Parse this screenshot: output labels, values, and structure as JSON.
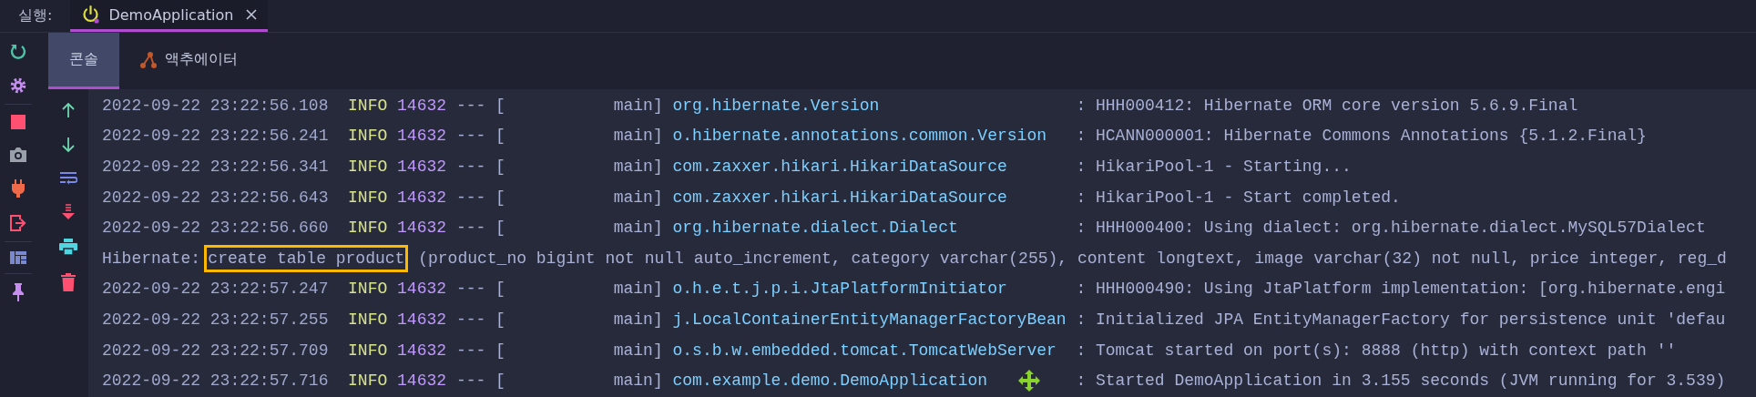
{
  "run_bar": {
    "label": "실행:",
    "tabs": [
      {
        "title": "DemoApplication",
        "selected": true
      }
    ]
  },
  "tool_tabs": [
    {
      "label": "콘솔",
      "kind": "console",
      "selected": true
    },
    {
      "label": "액추에이터",
      "kind": "actuator",
      "selected": false
    }
  ],
  "console_lines": [
    {
      "kind": "log",
      "timestamp": "2022-09-22 23:22:56.108",
      "level": "INFO",
      "pid": "14632",
      "separator": "---",
      "thread": "[           main]",
      "logger": "org.hibernate.Version",
      "message": ": HHH000412: Hibernate ORM core version 5.6.9.Final"
    },
    {
      "kind": "log",
      "timestamp": "2022-09-22 23:22:56.241",
      "level": "INFO",
      "pid": "14632",
      "separator": "---",
      "thread": "[           main]",
      "logger": "o.hibernate.annotations.common.Version",
      "message": ": HCANN000001: Hibernate Commons Annotations {5.1.2.Final}"
    },
    {
      "kind": "log",
      "timestamp": "2022-09-22 23:22:56.341",
      "level": "INFO",
      "pid": "14632",
      "separator": "---",
      "thread": "[           main]",
      "logger": "com.zaxxer.hikari.HikariDataSource",
      "message": ": HikariPool-1 - Starting..."
    },
    {
      "kind": "log",
      "timestamp": "2022-09-22 23:22:56.643",
      "level": "INFO",
      "pid": "14632",
      "separator": "---",
      "thread": "[           main]",
      "logger": "com.zaxxer.hikari.HikariDataSource",
      "message": ": HikariPool-1 - Start completed."
    },
    {
      "kind": "log",
      "timestamp": "2022-09-22 23:22:56.660",
      "level": "INFO",
      "pid": "14632",
      "separator": "---",
      "thread": "[           main]",
      "logger": "org.hibernate.dialect.Dialect",
      "message": ": HHH000400: Using dialect: org.hibernate.dialect.MySQL57Dialect"
    },
    {
      "kind": "sql",
      "prefix": "Hibernate:",
      "highlight": "create table product",
      "rest": "(product_no bigint not null auto_increment, category varchar(255), content longtext, image varchar(32) not null, price integer, reg_d"
    },
    {
      "kind": "log",
      "timestamp": "2022-09-22 23:22:57.247",
      "level": "INFO",
      "pid": "14632",
      "separator": "---",
      "thread": "[           main]",
      "logger": "o.h.e.t.j.p.i.JtaPlatformInitiator",
      "message": ": HHH000490: Using JtaPlatform implementation: [org.hibernate.engi"
    },
    {
      "kind": "log",
      "timestamp": "2022-09-22 23:22:57.255",
      "level": "INFO",
      "pid": "14632",
      "separator": "---",
      "thread": "[           main]",
      "logger": "j.LocalContainerEntityManagerFactoryBean",
      "message": ": Initialized JPA EntityManagerFactory for persistence unit 'defau"
    },
    {
      "kind": "log",
      "timestamp": "2022-09-22 23:22:57.709",
      "level": "INFO",
      "pid": "14632",
      "separator": "---",
      "thread": "[           main]",
      "logger": "o.s.b.w.embedded.tomcat.TomcatWebServer",
      "message": ": Tomcat started on port(s): 8888 (http) with context path ''"
    },
    {
      "kind": "log",
      "timestamp": "2022-09-22 23:22:57.716",
      "level": "INFO",
      "pid": "14632",
      "separator": "---",
      "thread": "[           main]",
      "logger": "com.example.demo.DemoApplication",
      "message": ": Started DemoApplication in 3.155 seconds (JVM running for 3.539)"
    }
  ]
}
